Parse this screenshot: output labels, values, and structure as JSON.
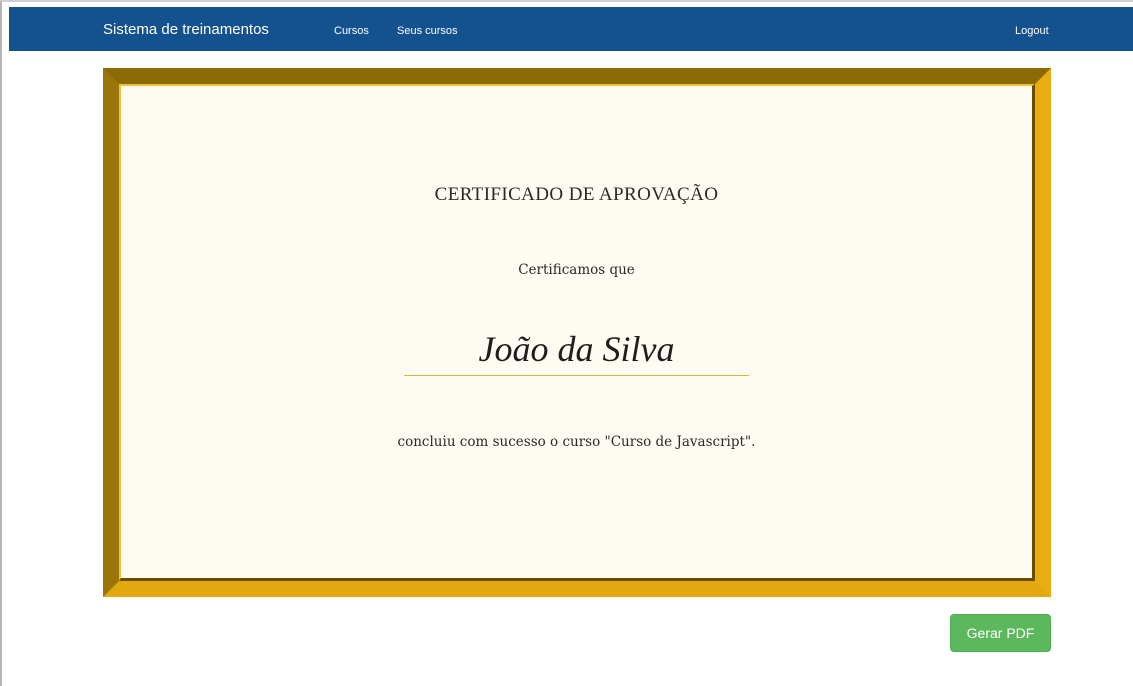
{
  "navbar": {
    "brand": "Sistema de treinamentos",
    "links": [
      "Cursos",
      "Seus cursos"
    ],
    "logout": "Logout",
    "background": "#13528f"
  },
  "certificate": {
    "title": "CERTIFICADO DE APROVAÇÃO",
    "intro": "Certificamos que",
    "name": "João da Silva",
    "body": "concluiu com sucesso o curso \"Curso de Javascript\".",
    "frame_color": "#e2a90f",
    "paper_color": "#fdfbf2"
  },
  "actions": {
    "generate_pdf": "Gerar PDF",
    "button_color": "#5cb85c"
  }
}
